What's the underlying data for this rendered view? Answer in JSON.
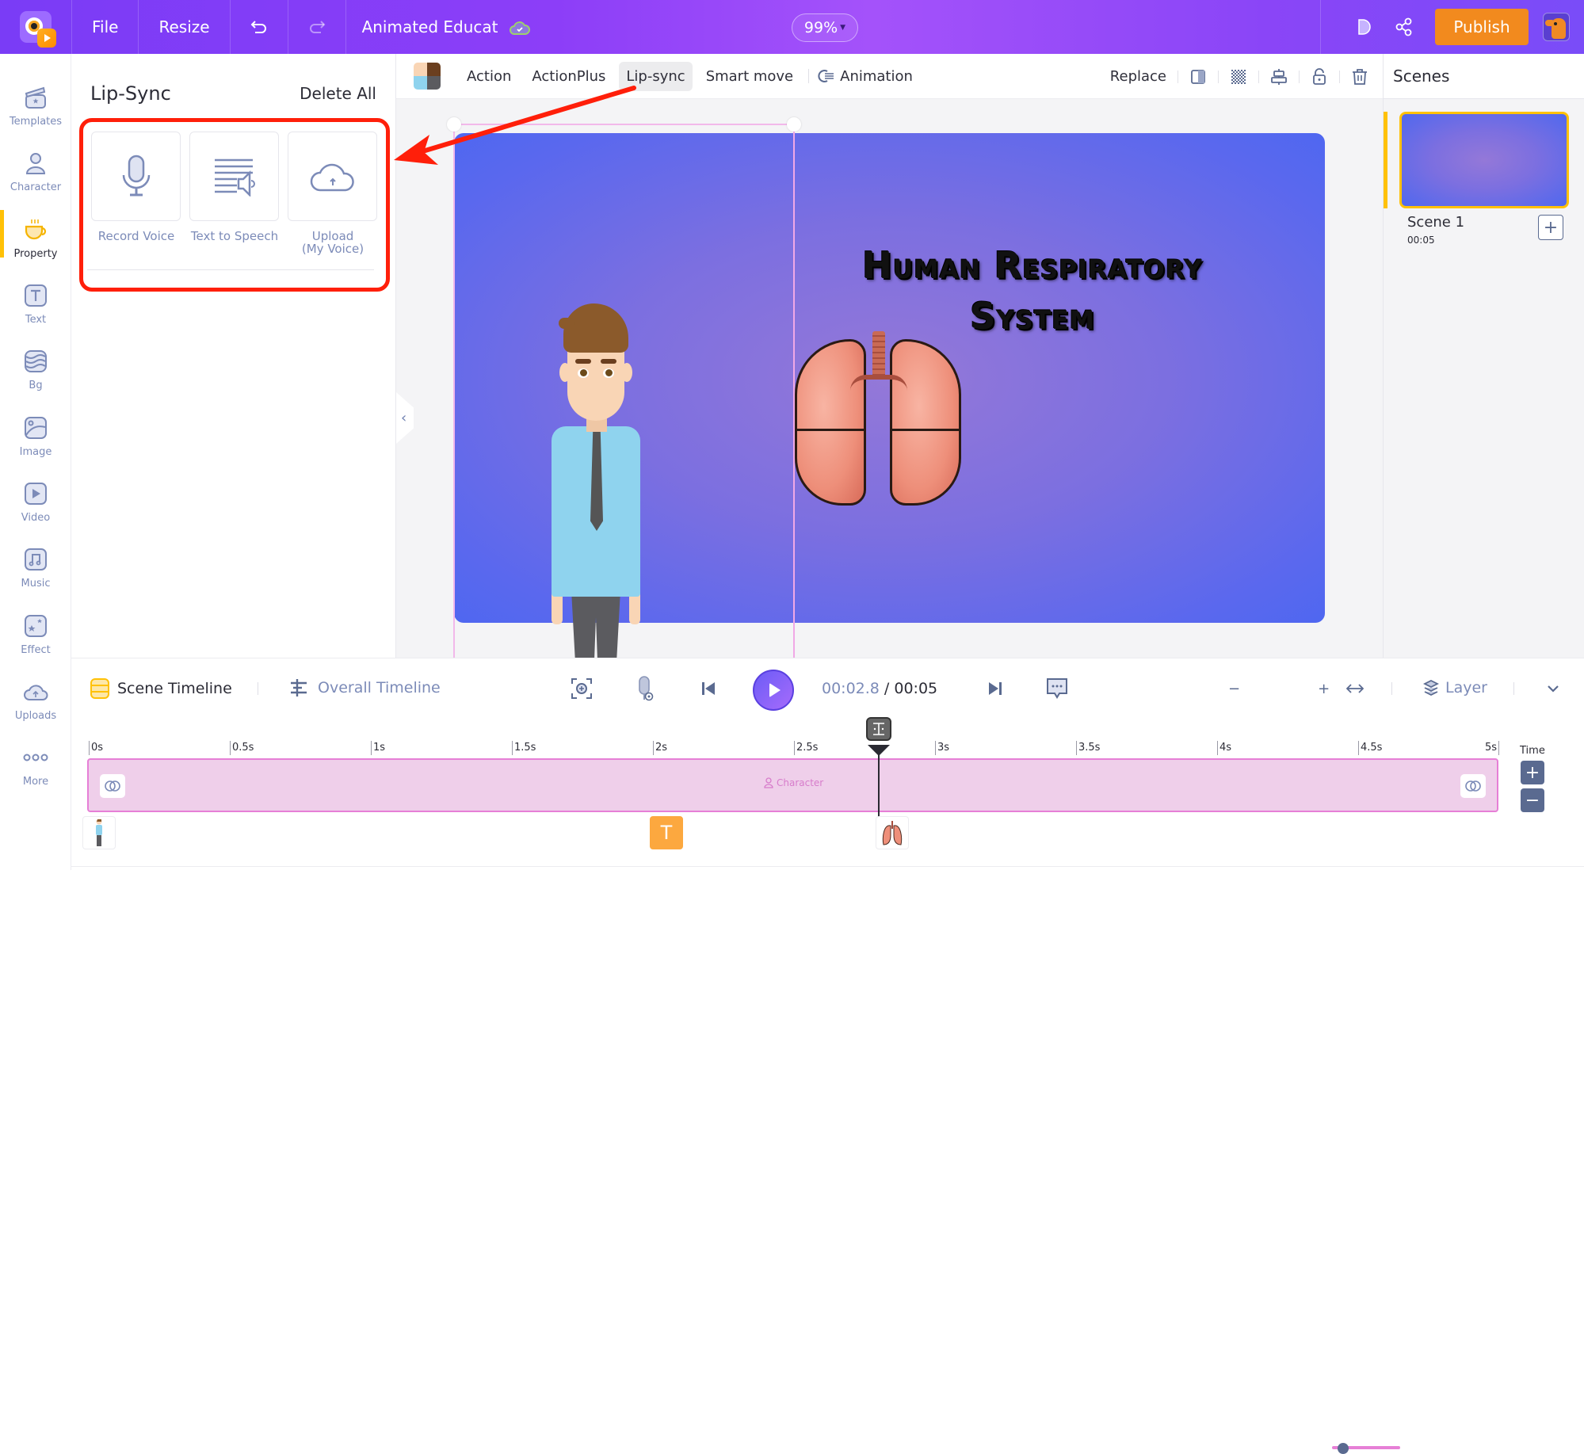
{
  "topbar": {
    "menu": [
      "File",
      "Resize"
    ],
    "undo_icon": "undo-icon",
    "redo_icon": "redo-icon",
    "project_title": "Animated Educat",
    "save_status_icon": "cloud-check-icon",
    "zoom_level": "99%",
    "preview_icon": "play-preview-icon",
    "share_icon": "share-icon",
    "publish_label": "Publish",
    "avatar_icon": "user-avatar"
  },
  "sidebar": {
    "items": [
      {
        "label": "Templates",
        "icon": "templates-icon",
        "active": false
      },
      {
        "label": "Character",
        "icon": "character-icon",
        "active": false
      },
      {
        "label": "Property",
        "icon": "property-cup-icon",
        "active": true
      },
      {
        "label": "Text",
        "icon": "text-icon",
        "active": false
      },
      {
        "label": "Bg",
        "icon": "background-icon",
        "active": false
      },
      {
        "label": "Image",
        "icon": "image-icon",
        "active": false
      },
      {
        "label": "Video",
        "icon": "video-icon",
        "active": false
      },
      {
        "label": "Music",
        "icon": "music-icon",
        "active": false
      },
      {
        "label": "Effect",
        "icon": "effect-icon",
        "active": false
      },
      {
        "label": "Uploads",
        "icon": "uploads-icon",
        "active": false
      },
      {
        "label": "More",
        "icon": "more-icon",
        "active": false
      }
    ]
  },
  "lipsync_panel": {
    "title": "Lip-Sync",
    "delete_all": "Delete All",
    "options": [
      {
        "label": "Record Voice",
        "icon": "microphone-icon"
      },
      {
        "label": "Text to Speech",
        "icon": "text-to-speech-icon"
      },
      {
        "label": "Upload\n(My Voice)",
        "label_line1": "Upload",
        "label_line2": "(My Voice)",
        "icon": "cloud-upload-icon"
      }
    ]
  },
  "property_toolbar": {
    "tabs": [
      "Action",
      "ActionPlus",
      "Lip-sync",
      "Smart move"
    ],
    "active_tab": "Lip-sync",
    "animation_label": "Animation",
    "replace_label": "Replace",
    "tools": [
      "flip-icon",
      "transparency-icon",
      "align-icon",
      "lock-icon",
      "delete-icon"
    ]
  },
  "canvas": {
    "title_line1": "Human Respiratory",
    "title_line2": "System",
    "elements": [
      "character",
      "lungs-image"
    ]
  },
  "scenes": {
    "header": "Scenes",
    "items": [
      {
        "name": "Scene 1",
        "duration": "00:05",
        "active": true
      }
    ],
    "add_icon": "add-scene-icon"
  },
  "timeline": {
    "scene_tab": "Scene Timeline",
    "overall_tab": "Overall Timeline",
    "current_time": "00:02.8",
    "separator": " / ",
    "total_time": "00:05",
    "layer_label": "Layer",
    "time_label": "Time",
    "zoom_level_fraction": 0.1,
    "ruler_ticks": [
      "0s",
      "0.5s",
      "1s",
      "1.5s",
      "2s",
      "2.5s",
      "3s",
      "3.5s",
      "4s",
      "4.5s",
      "5s"
    ],
    "track_label": "Character",
    "playhead_seconds": 2.8,
    "items": [
      {
        "type": "character",
        "start_seconds": 0
      },
      {
        "type": "text",
        "label": "T",
        "start_seconds": 2.0
      },
      {
        "type": "lungs-image",
        "start_seconds": 2.8
      }
    ]
  },
  "colors": {
    "accent_purple": "#7a3cf6",
    "publish_orange": "#f28a1e",
    "active_yellow": "#ffc107",
    "track_pink": "#efcfea",
    "annotation_red": "#ff1f0a"
  }
}
